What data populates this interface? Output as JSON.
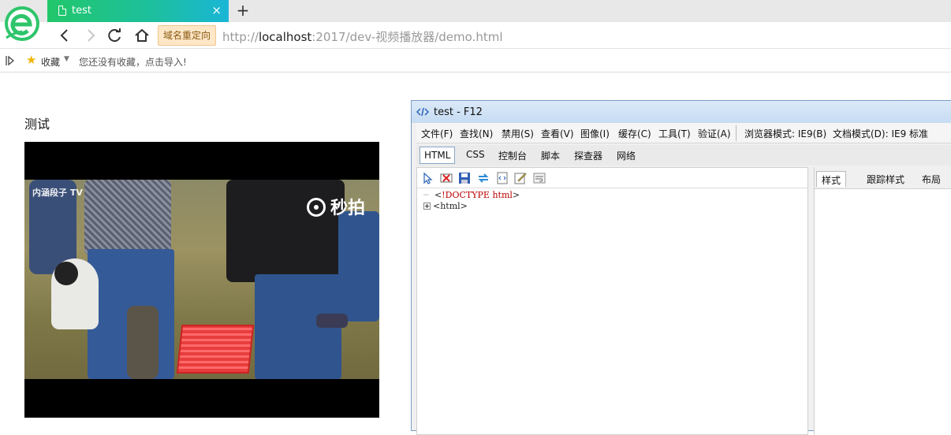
{
  "browser": {
    "tab_title": "test",
    "tab_close_glyph": "×",
    "new_tab_glyph": "+",
    "redirect_badge": "域名重定向",
    "url_prefix": "http://",
    "url_host": "localhost",
    "url_rest": ":2017/dev-视频播放器/demo.html",
    "accent_color": "#22c76a"
  },
  "bookmarks": {
    "favorites_label": "收藏",
    "empty_text": "您还没有收藏，点击导入!"
  },
  "page": {
    "heading": "测试",
    "video": {
      "watermark_left": "内涵段子 TV",
      "watermark_right": "秒拍"
    }
  },
  "devtools": {
    "title": "test - F12",
    "menu": [
      "文件(F)",
      "查找(N)",
      "禁用(S)",
      "查看(V)",
      "图像(I)",
      "缓存(C)",
      "工具(T)",
      "验证(A)",
      "浏览器模式: IE9(B)",
      "文档模式(D): IE9 标准"
    ],
    "tabs": [
      "HTML",
      "CSS",
      "控制台",
      "脚本",
      "探查器",
      "网络"
    ],
    "active_tab": "HTML",
    "tree": {
      "doctype_open": "<",
      "doctype_kw": "!DOCTYPE",
      "doctype_val": "html",
      "doctype_close": ">",
      "html_node": "<html>"
    },
    "style_tabs": [
      "样式",
      "跟踪样式",
      "布局"
    ],
    "toolbar_icons": [
      "select-element-icon",
      "clear-highlight-icon",
      "save-icon",
      "refresh-icon",
      "source-icon",
      "edit-icon",
      "word-wrap-icon"
    ]
  }
}
